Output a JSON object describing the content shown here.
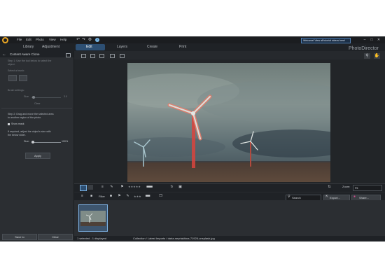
{
  "menu": [
    "File",
    "Edit",
    "Photo",
    "View",
    "Help"
  ],
  "quick_actions": [
    "undo-icon",
    "redo-icon",
    "settings-icon",
    "help-icon"
  ],
  "notification": "Welcome! View all tutorial videos here!",
  "window_controls": [
    "minimize",
    "maximize",
    "close"
  ],
  "modules": {
    "library": "Library",
    "adjustment": "Adjustment",
    "edit": "Edit",
    "layers": "Layers",
    "create": "Create",
    "print": "Print"
  },
  "brand": "PhotoDirector",
  "panel": {
    "title": "Content Aware Clone",
    "step1": [
      "Step 1: Use the tool below to select the",
      "object."
    ],
    "select_brush": "Select a brush:",
    "brush_settings": "Brush settings:",
    "size_label": "Size",
    "size_value": "3.0",
    "clear_label": "Clear",
    "step2": [
      "Step 2: Drag and move the selected area",
      "to another region of the photo."
    ],
    "show_mask": "Show mask",
    "adjust_note": [
      "If required, adjust the object's size with",
      "the below slider."
    ],
    "size2_label": "Size:",
    "size2_value": "100%",
    "apply_label": "Apply",
    "save_label": "Save to",
    "clear_bottom_label": "Clear"
  },
  "filmstrip": {
    "zoom_label": "Zoom:",
    "zoom_value": "Fit",
    "filter_label": "Filter",
    "search_placeholder": "Search",
    "export_label": "Export...",
    "share_label": "Share..."
  },
  "status": {
    "selected": "1 selected - 1 displayed",
    "path": "Collection / Latest Imports / daria-nepriakhina-71926-unsplash.jpg"
  },
  "colors": {
    "accent": "#2d4f73",
    "selection_outline": "#d9705a",
    "highlight_blue": "#7db1e3",
    "logo": "#e9a524"
  }
}
